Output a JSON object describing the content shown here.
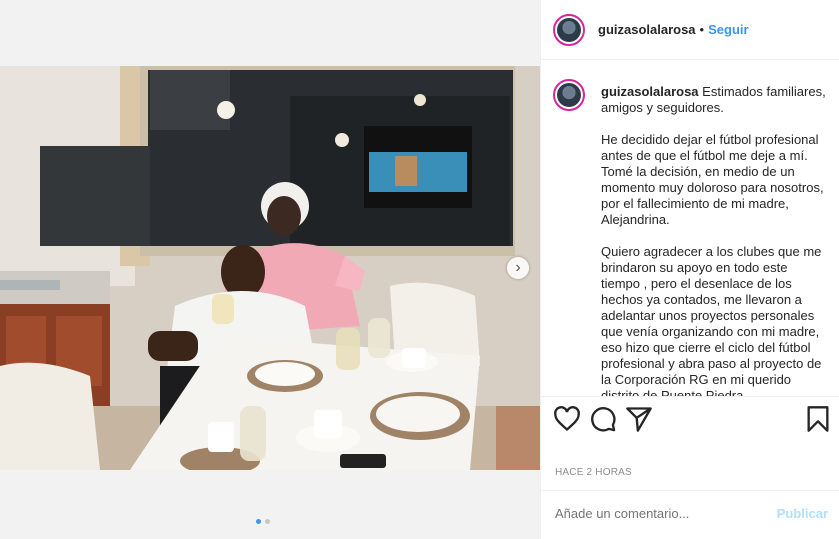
{
  "post": {
    "username": "guizasolalarosa",
    "follow_label": "Seguir",
    "separator": "•",
    "caption_text": "Estimados familiares, amigos y seguidores.\n\nHe decidido dejar el fútbol profesional antes de que el fútbol me deje a mí. Tomé la decisión, en medio de un momento muy doloroso para nosotros, por el fallecimiento de mi madre, Alejandrina.\n\nQuiero agradecer a los clubes que me brindaron su apoyo en todo este tiempo , pero el desenlace de los hechos ya contados, me llevaron a adelantar unos proyectos personales que venía organizando con mi madre, eso hizo que cierre el ciclo del fútbol profesional y abra paso al proyecto de la Corporación RG en mi querido distrito de Puente Piedra.",
    "timestamp": "HACE 2 HORAS",
    "comment_placeholder": "Añade un comentario...",
    "publish_label": "Publicar"
  },
  "carousel": {
    "slide_count": 2,
    "active_index": 0
  },
  "icons": [
    "chevron-right-icon",
    "heart-icon",
    "comment-icon",
    "share-icon",
    "bookmark-icon"
  ],
  "colors": {
    "link": "#3897f0",
    "publish_disabled": "#b2dffc",
    "text": "#262626",
    "muted": "#8e8e8e"
  }
}
